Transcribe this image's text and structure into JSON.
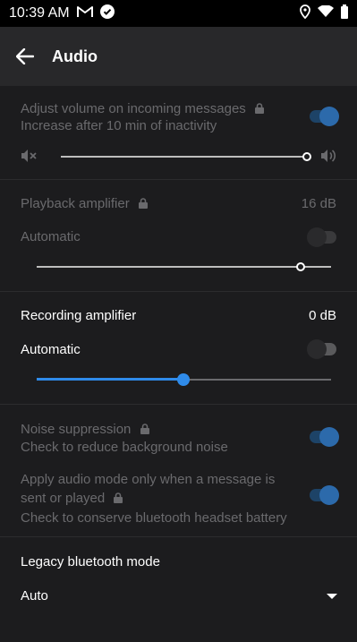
{
  "status_bar": {
    "time": "10:39 AM"
  },
  "app_bar": {
    "title": "Audio"
  },
  "adjust_volume": {
    "title": "Adjust volume on incoming messages",
    "summary": "Increase after 10 min of inactivity",
    "toggle_on": true,
    "slider_level": 1.0
  },
  "playback_amplifier": {
    "title": "Playback amplifier",
    "value": "16 dB",
    "automatic_label": "Automatic",
    "automatic_on": false,
    "slider_level": 0.94
  },
  "recording_amplifier": {
    "title": "Recording amplifier",
    "value": "0 dB",
    "automatic_label": "Automatic",
    "automatic_on": false,
    "slider_level": 0.5
  },
  "noise_suppression": {
    "title": "Noise suppression",
    "summary": "Check to reduce background noise",
    "toggle_on": true
  },
  "audio_mode": {
    "title_line1": "Apply audio mode only when a message is",
    "title_line2": "sent or played",
    "summary": "Check to conserve bluetooth headset battery",
    "toggle_on": true
  },
  "legacy_bluetooth": {
    "title": "Legacy bluetooth mode",
    "selected": "Auto"
  },
  "colors": {
    "accent": "#2f8bea",
    "toggle_on_knob": "#2f78c4",
    "disabled_text": "#6a6a6d"
  }
}
